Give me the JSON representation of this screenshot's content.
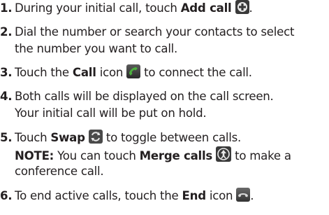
{
  "steps": [
    {
      "number": "1.",
      "lines": [
        {
          "parts": [
            "During your initial call, touch ",
            "Add call",
            "."
          ]
        }
      ],
      "icon": "add-call-icon"
    },
    {
      "number": "2.",
      "lines": [
        {
          "text": "Dial the number or search your contacts to select"
        },
        {
          "text": "the number you want to call."
        }
      ]
    },
    {
      "number": "3.",
      "lines": [
        {
          "parts": [
            "Touch the ",
            "Call",
            " icon ",
            " to connect the call."
          ]
        }
      ],
      "icon": "call-icon"
    },
    {
      "number": "4.",
      "lines": [
        {
          "text": "Both calls will be displayed on the call screen."
        },
        {
          "text": "Your initial call will be put on hold."
        }
      ]
    },
    {
      "number": "5.",
      "lines": [
        {
          "parts": [
            "Touch ",
            "Swap",
            " to toggle between calls."
          ]
        },
        {
          "parts": [
            "NOTE:",
            " You can touch ",
            "Merge calls",
            " to make a"
          ]
        },
        {
          "text": "conference call."
        }
      ],
      "icons": [
        "swap-icon",
        "merge-calls-icon"
      ]
    },
    {
      "number": "6.",
      "lines": [
        {
          "parts": [
            "To end active calls, touch the ",
            "End",
            " icon ",
            "."
          ]
        }
      ],
      "icon": "end-call-icon"
    }
  ],
  "colors": {
    "text": "#231f20",
    "icon_dark": "#3a3a3a",
    "call_green": "#3f9c35",
    "end_red": "#c0392b"
  }
}
